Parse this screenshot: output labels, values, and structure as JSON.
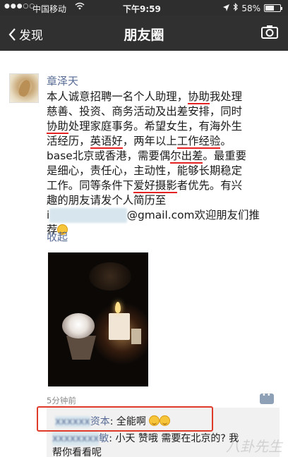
{
  "status_bar": {
    "signal": "●●●○○",
    "carrier": "中国移动",
    "time": "下午9:59",
    "battery": "58%",
    "battery_level": 0.58
  },
  "nav": {
    "back_label": "发现",
    "title": "朋友圈"
  },
  "post": {
    "author": "章泽天",
    "lines": [
      [
        "本人诚意招聘一名个人助理，",
        "协助",
        "我处理"
      ],
      [
        "慈善、投资、商务活动及出差安排，同时"
      ],
      [
        "协助",
        "处理家庭事务。希望女生，有海外生"
      ],
      [
        "活经历，",
        "英语好",
        "，两年以上",
        "工作经验",
        "。"
      ],
      [
        "base北京或香港，需要偶",
        "尔出差",
        "。最重要"
      ],
      [
        "是细心，责任心，主动性，能够长期稳定"
      ],
      [
        "工作。同等条件下",
        "爱好摄影",
        "者优先。有兴"
      ],
      [
        "趣的朋友请发个人简历至"
      ],
      [
        "i",
        "xxxxxxxxxxxx",
        "@gmail.com欢迎朋友们推"
      ],
      [
        "荐"
      ]
    ],
    "collapse_label": "收起",
    "time": "5分钟前"
  },
  "comments": [
    {
      "name_hidden": "xxxxxx",
      "name_suffix": "资本",
      "text": ": 全能啊"
    },
    {
      "name_hidden": "xxxxxxxx",
      "name_suffix": "敏",
      "text": ": 小天 赞哦 需要在北京的? 我"
    }
  ],
  "comment_continued": "帮你看看呢",
  "watermark": "八卦先生",
  "colors": {
    "nav_bg": "#303030",
    "link": "#576b95",
    "highlight": "#e52222"
  }
}
